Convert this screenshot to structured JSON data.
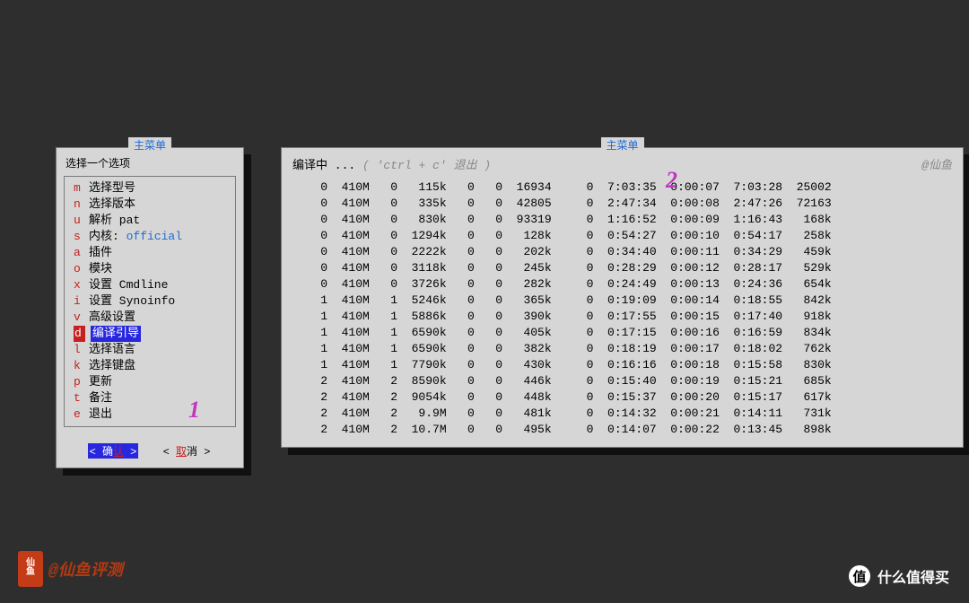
{
  "left": {
    "main_title": "主菜单",
    "prompt": "选择一个选项",
    "items": [
      {
        "key": "m",
        "label": "选择型号"
      },
      {
        "key": "n",
        "label": "选择版本"
      },
      {
        "key": "u",
        "label": "解析 pat"
      },
      {
        "key": "s",
        "label": "内核: ",
        "suffix": "official"
      },
      {
        "key": "a",
        "label": "插件"
      },
      {
        "key": "o",
        "label": "模块"
      },
      {
        "key": "x",
        "label": "设置 Cmdline"
      },
      {
        "key": "i",
        "label": "设置 Synoinfo"
      },
      {
        "key": "v",
        "label": "高级设置"
      },
      {
        "key": "d",
        "label": "编译引导",
        "selected": true
      },
      {
        "key": "l",
        "label": "选择语言"
      },
      {
        "key": "k",
        "label": "选择键盘"
      },
      {
        "key": "p",
        "label": "更新"
      },
      {
        "key": "t",
        "label": "备注"
      },
      {
        "key": "e",
        "label": "退出"
      }
    ],
    "ok_pre": "< 确",
    "ok_u": "认",
    "ok_post": " >",
    "cancel_pre": "< ",
    "cancel_u": "取",
    "cancel_post": "消 >",
    "overlay1": "1"
  },
  "right": {
    "main_title": "主菜单",
    "heading": "编译中 ...",
    "heading_sub": "( 'ctrl + c' 退出 )",
    "handle": "@仙鱼",
    "overlay2": "2",
    "rows": [
      [
        0,
        "410M",
        0,
        "115k",
        0,
        0,
        "16934",
        0,
        "7:03:35",
        "0:00:07",
        "7:03:28",
        "25002"
      ],
      [
        0,
        "410M",
        0,
        "335k",
        0,
        0,
        "42805",
        0,
        "2:47:34",
        "0:00:08",
        "2:47:26",
        "72163"
      ],
      [
        0,
        "410M",
        0,
        "830k",
        0,
        0,
        "93319",
        0,
        "1:16:52",
        "0:00:09",
        "1:16:43",
        "168k"
      ],
      [
        0,
        "410M",
        0,
        "1294k",
        0,
        0,
        "128k",
        0,
        "0:54:27",
        "0:00:10",
        "0:54:17",
        "258k"
      ],
      [
        0,
        "410M",
        0,
        "2222k",
        0,
        0,
        "202k",
        0,
        "0:34:40",
        "0:00:11",
        "0:34:29",
        "459k"
      ],
      [
        0,
        "410M",
        0,
        "3118k",
        0,
        0,
        "245k",
        0,
        "0:28:29",
        "0:00:12",
        "0:28:17",
        "529k"
      ],
      [
        0,
        "410M",
        0,
        "3726k",
        0,
        0,
        "282k",
        0,
        "0:24:49",
        "0:00:13",
        "0:24:36",
        "654k"
      ],
      [
        1,
        "410M",
        1,
        "5246k",
        0,
        0,
        "365k",
        0,
        "0:19:09",
        "0:00:14",
        "0:18:55",
        "842k"
      ],
      [
        1,
        "410M",
        1,
        "5886k",
        0,
        0,
        "390k",
        0,
        "0:17:55",
        "0:00:15",
        "0:17:40",
        "918k"
      ],
      [
        1,
        "410M",
        1,
        "6590k",
        0,
        0,
        "405k",
        0,
        "0:17:15",
        "0:00:16",
        "0:16:59",
        "834k"
      ],
      [
        1,
        "410M",
        1,
        "6590k",
        0,
        0,
        "382k",
        0,
        "0:18:19",
        "0:00:17",
        "0:18:02",
        "762k"
      ],
      [
        1,
        "410M",
        1,
        "7790k",
        0,
        0,
        "430k",
        0,
        "0:16:16",
        "0:00:18",
        "0:15:58",
        "830k"
      ],
      [
        2,
        "410M",
        2,
        "8590k",
        0,
        0,
        "446k",
        0,
        "0:15:40",
        "0:00:19",
        "0:15:21",
        "685k"
      ],
      [
        2,
        "410M",
        2,
        "9054k",
        0,
        0,
        "448k",
        0,
        "0:15:37",
        "0:00:20",
        "0:15:17",
        "617k"
      ],
      [
        2,
        "410M",
        2,
        " 9.9M",
        0,
        0,
        "481k",
        0,
        "0:14:32",
        "0:00:21",
        "0:14:11",
        "731k"
      ],
      [
        2,
        "410M",
        2,
        "10.7M",
        0,
        0,
        "495k",
        0,
        "0:14:07",
        "0:00:22",
        "0:13:45",
        "898k"
      ]
    ]
  },
  "footer": {
    "stamp_text": "@仙鱼评测",
    "seal_top": "仙",
    "seal_bot": "鱼",
    "smzdm_badge": "值",
    "smzdm_text": "什么值得买"
  }
}
